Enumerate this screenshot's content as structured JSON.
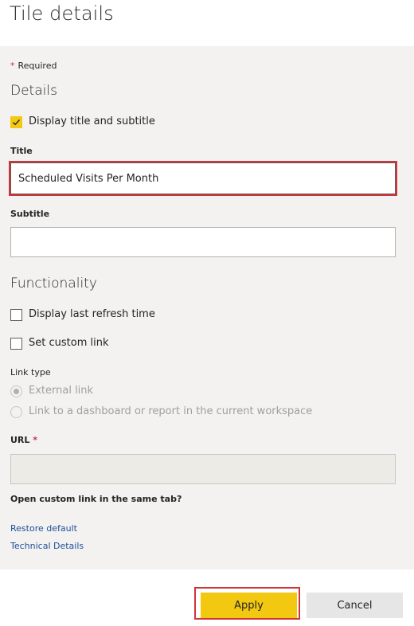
{
  "header": {
    "title": "Tile details"
  },
  "required_note": {
    "star": "*",
    "text": "Required"
  },
  "details": {
    "heading": "Details",
    "display_title_checkbox": {
      "label": "Display title and subtitle",
      "checked": true
    },
    "title_field": {
      "label": "Title",
      "value": "Scheduled Visits Per Month"
    },
    "subtitle_field": {
      "label": "Subtitle",
      "value": ""
    }
  },
  "functionality": {
    "heading": "Functionality",
    "display_refresh_checkbox": {
      "label": "Display last refresh time",
      "checked": false
    },
    "custom_link_checkbox": {
      "label": "Set custom link",
      "checked": false
    },
    "link_type": {
      "label": "Link type",
      "options": [
        {
          "label": "External link",
          "selected": true
        },
        {
          "label": "Link to a dashboard or report in the current workspace",
          "selected": false
        }
      ]
    },
    "url_field": {
      "label": "URL",
      "star": "*",
      "value": ""
    },
    "same_tab_label": "Open custom link in the same tab?"
  },
  "links": {
    "restore_default": "Restore default",
    "technical_details": "Technical Details"
  },
  "footer": {
    "apply_label": "Apply",
    "cancel_label": "Cancel"
  },
  "colors": {
    "accent": "#f2c811",
    "highlight": "#d13438",
    "link": "#1f4e99",
    "panel": "#f3f2f1"
  }
}
